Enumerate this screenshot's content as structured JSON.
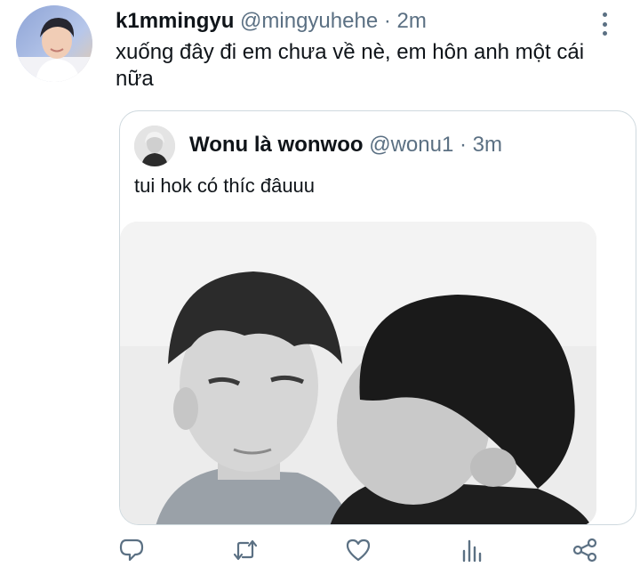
{
  "tweet": {
    "author_name": "k1mmingyu",
    "author_handle": "@mingyuhehe",
    "separator": "·",
    "time": "2m",
    "text": "xuống đây đi em chưa về nè, em hôn anh một cái nữa"
  },
  "quoted_tweet": {
    "author_name": "Wonu là wonwoo",
    "author_handle": "@wonu1",
    "separator": "·",
    "time": "3m",
    "text": "tui hok có thíc đâuuu"
  },
  "actions": {
    "icons": [
      "reply-icon",
      "retweet-icon",
      "like-icon",
      "analytics-icon",
      "share-icon"
    ]
  },
  "colors": {
    "text_primary": "#0f1419",
    "text_secondary": "#5b7083",
    "border": "#cfd9de",
    "icon": "#5b7083"
  }
}
